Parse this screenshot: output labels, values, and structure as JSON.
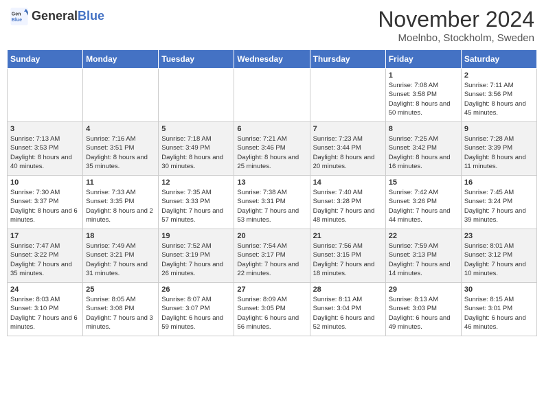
{
  "logo": {
    "general": "General",
    "blue": "Blue"
  },
  "title": "November 2024",
  "subtitle": "Moelnbo, Stockholm, Sweden",
  "days_of_week": [
    "Sunday",
    "Monday",
    "Tuesday",
    "Wednesday",
    "Thursday",
    "Friday",
    "Saturday"
  ],
  "weeks": [
    [
      {
        "day": "",
        "info": ""
      },
      {
        "day": "",
        "info": ""
      },
      {
        "day": "",
        "info": ""
      },
      {
        "day": "",
        "info": ""
      },
      {
        "day": "",
        "info": ""
      },
      {
        "day": "1",
        "info": "Sunrise: 7:08 AM\nSunset: 3:58 PM\nDaylight: 8 hours and 50 minutes."
      },
      {
        "day": "2",
        "info": "Sunrise: 7:11 AM\nSunset: 3:56 PM\nDaylight: 8 hours and 45 minutes."
      }
    ],
    [
      {
        "day": "3",
        "info": "Sunrise: 7:13 AM\nSunset: 3:53 PM\nDaylight: 8 hours and 40 minutes."
      },
      {
        "day": "4",
        "info": "Sunrise: 7:16 AM\nSunset: 3:51 PM\nDaylight: 8 hours and 35 minutes."
      },
      {
        "day": "5",
        "info": "Sunrise: 7:18 AM\nSunset: 3:49 PM\nDaylight: 8 hours and 30 minutes."
      },
      {
        "day": "6",
        "info": "Sunrise: 7:21 AM\nSunset: 3:46 PM\nDaylight: 8 hours and 25 minutes."
      },
      {
        "day": "7",
        "info": "Sunrise: 7:23 AM\nSunset: 3:44 PM\nDaylight: 8 hours and 20 minutes."
      },
      {
        "day": "8",
        "info": "Sunrise: 7:25 AM\nSunset: 3:42 PM\nDaylight: 8 hours and 16 minutes."
      },
      {
        "day": "9",
        "info": "Sunrise: 7:28 AM\nSunset: 3:39 PM\nDaylight: 8 hours and 11 minutes."
      }
    ],
    [
      {
        "day": "10",
        "info": "Sunrise: 7:30 AM\nSunset: 3:37 PM\nDaylight: 8 hours and 6 minutes."
      },
      {
        "day": "11",
        "info": "Sunrise: 7:33 AM\nSunset: 3:35 PM\nDaylight: 8 hours and 2 minutes."
      },
      {
        "day": "12",
        "info": "Sunrise: 7:35 AM\nSunset: 3:33 PM\nDaylight: 7 hours and 57 minutes."
      },
      {
        "day": "13",
        "info": "Sunrise: 7:38 AM\nSunset: 3:31 PM\nDaylight: 7 hours and 53 minutes."
      },
      {
        "day": "14",
        "info": "Sunrise: 7:40 AM\nSunset: 3:28 PM\nDaylight: 7 hours and 48 minutes."
      },
      {
        "day": "15",
        "info": "Sunrise: 7:42 AM\nSunset: 3:26 PM\nDaylight: 7 hours and 44 minutes."
      },
      {
        "day": "16",
        "info": "Sunrise: 7:45 AM\nSunset: 3:24 PM\nDaylight: 7 hours and 39 minutes."
      }
    ],
    [
      {
        "day": "17",
        "info": "Sunrise: 7:47 AM\nSunset: 3:22 PM\nDaylight: 7 hours and 35 minutes."
      },
      {
        "day": "18",
        "info": "Sunrise: 7:49 AM\nSunset: 3:21 PM\nDaylight: 7 hours and 31 minutes."
      },
      {
        "day": "19",
        "info": "Sunrise: 7:52 AM\nSunset: 3:19 PM\nDaylight: 7 hours and 26 minutes."
      },
      {
        "day": "20",
        "info": "Sunrise: 7:54 AM\nSunset: 3:17 PM\nDaylight: 7 hours and 22 minutes."
      },
      {
        "day": "21",
        "info": "Sunrise: 7:56 AM\nSunset: 3:15 PM\nDaylight: 7 hours and 18 minutes."
      },
      {
        "day": "22",
        "info": "Sunrise: 7:59 AM\nSunset: 3:13 PM\nDaylight: 7 hours and 14 minutes."
      },
      {
        "day": "23",
        "info": "Sunrise: 8:01 AM\nSunset: 3:12 PM\nDaylight: 7 hours and 10 minutes."
      }
    ],
    [
      {
        "day": "24",
        "info": "Sunrise: 8:03 AM\nSunset: 3:10 PM\nDaylight: 7 hours and 6 minutes."
      },
      {
        "day": "25",
        "info": "Sunrise: 8:05 AM\nSunset: 3:08 PM\nDaylight: 7 hours and 3 minutes."
      },
      {
        "day": "26",
        "info": "Sunrise: 8:07 AM\nSunset: 3:07 PM\nDaylight: 6 hours and 59 minutes."
      },
      {
        "day": "27",
        "info": "Sunrise: 8:09 AM\nSunset: 3:05 PM\nDaylight: 6 hours and 56 minutes."
      },
      {
        "day": "28",
        "info": "Sunrise: 8:11 AM\nSunset: 3:04 PM\nDaylight: 6 hours and 52 minutes."
      },
      {
        "day": "29",
        "info": "Sunrise: 8:13 AM\nSunset: 3:03 PM\nDaylight: 6 hours and 49 minutes."
      },
      {
        "day": "30",
        "info": "Sunrise: 8:15 AM\nSunset: 3:01 PM\nDaylight: 6 hours and 46 minutes."
      }
    ]
  ]
}
